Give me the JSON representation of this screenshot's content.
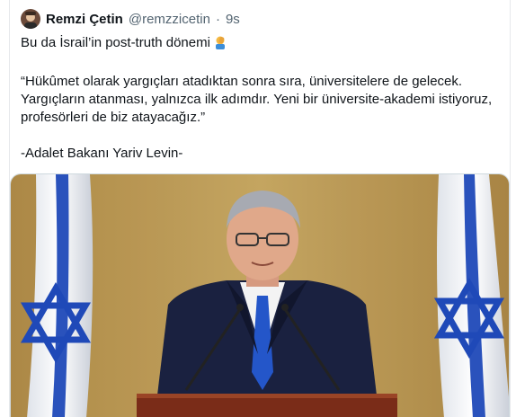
{
  "tweet": {
    "author_name": "Remzi Çetin",
    "author_handle": "@remzzicetin",
    "separator": "·",
    "timestamp": "9s",
    "line1": "Bu da İsrail’in post-truth dönemi",
    "quote_line1": "“Hükûmet olarak yargıçları atadıktan sonra sıra, üniversitelere de gelecek.",
    "quote_line2": "Yargıçların atanması, yalnızca ilk adımdır. Yeni bir üniversite-akademi istiyoruz,",
    "quote_line3": "profesörleri de biz atayacağız.”",
    "attribution": "-Adalet Bakanı Yariv Levin-",
    "emoji": "man-facepalming-icon"
  },
  "media": {
    "description": "photo",
    "colors": {
      "background": "#c4a35a",
      "flag_blue": "#1f49b8",
      "suit": "#1a2140",
      "tie": "#2456c9",
      "podium": "#7a2c18"
    }
  }
}
